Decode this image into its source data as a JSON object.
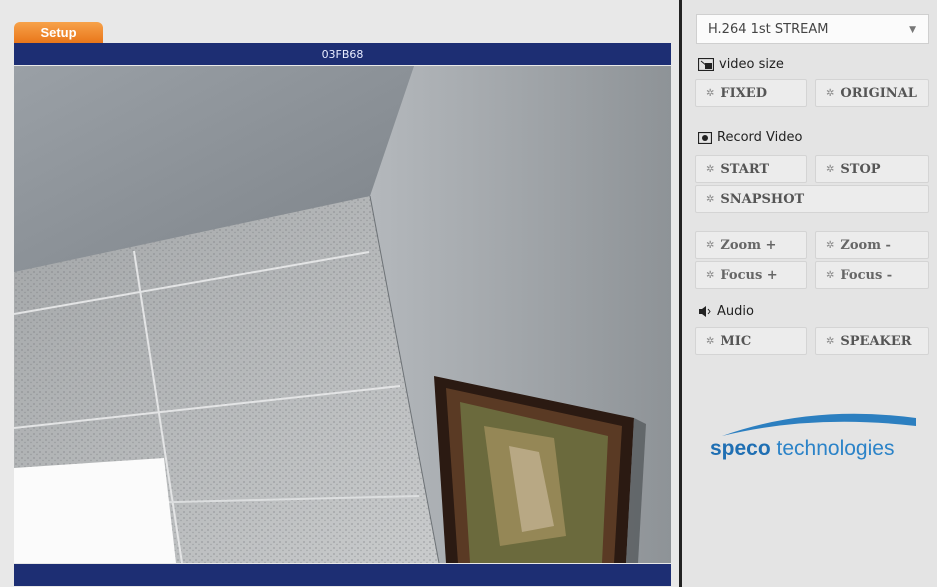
{
  "header": {
    "setup_tab": "Setup",
    "camera_name": "03FB68"
  },
  "panel": {
    "stream_select": {
      "value": "H.264 1st STREAM"
    },
    "video_size": {
      "title": "video size",
      "fixed": "FIXED",
      "original": "ORIGINAL"
    },
    "record": {
      "title": "Record Video",
      "start": "START",
      "stop": "STOP",
      "snapshot": "SNAPSHOT"
    },
    "ptz": {
      "zoom_in": "Zoom +",
      "zoom_out": "Zoom -",
      "focus_in": "Focus +",
      "focus_out": "Focus -"
    },
    "audio": {
      "title": "Audio",
      "mic": "MIC",
      "speaker": "SPEAKER"
    },
    "logo": {
      "part1": "speco",
      "part2": " technologies"
    }
  },
  "icons": {
    "gear": "gear-icon",
    "video_size": "resize-icon",
    "record": "record-icon",
    "audio": "speaker-icon",
    "dropdown": "chevron-down-icon"
  },
  "colors": {
    "title_bar": "#1d2e73",
    "setup_tab": "#e9761a",
    "logo_blue": "#1f6fb3"
  }
}
